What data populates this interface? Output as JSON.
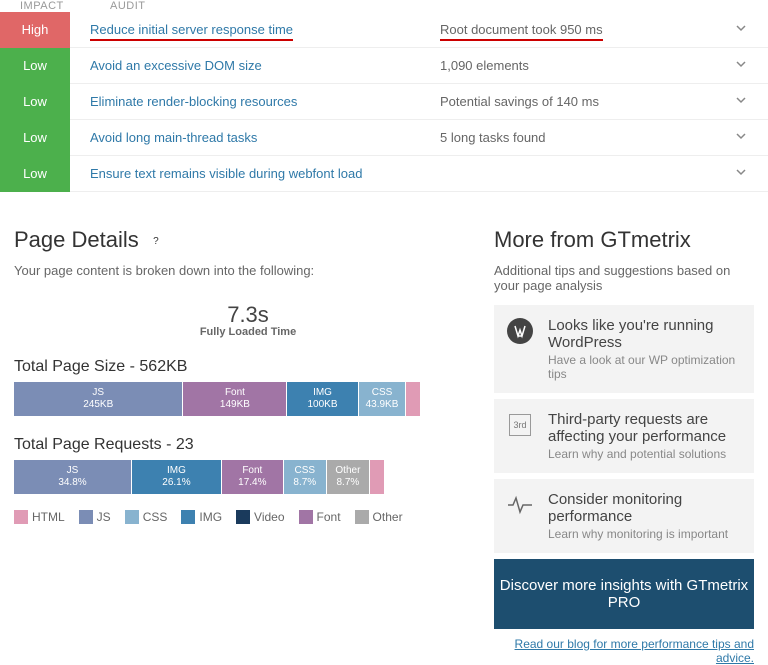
{
  "headers": {
    "impact": "IMPACT",
    "audit": "AUDIT"
  },
  "audits": [
    {
      "impact": "High",
      "name": "Reduce initial server response time",
      "detail": "Root document took 950 ms",
      "high": true
    },
    {
      "impact": "Low",
      "name": "Avoid an excessive DOM size",
      "detail": "1,090 elements"
    },
    {
      "impact": "Low",
      "name": "Eliminate render-blocking resources",
      "detail": "Potential savings of 140 ms"
    },
    {
      "impact": "Low",
      "name": "Avoid long main-thread tasks",
      "detail": "5 long tasks found"
    },
    {
      "impact": "Low",
      "name": "Ensure text remains visible during webfont load",
      "detail": ""
    }
  ],
  "page_details": {
    "title": "Page Details",
    "subtext": "Your page content is broken down into the following:",
    "flt_value": "7.3s",
    "flt_label": "Fully Loaded Time",
    "size_title": "Total Page Size - 562KB",
    "size_segs": [
      {
        "l1": "JS",
        "l2": "245KB",
        "w": 36,
        "c": "c-js"
      },
      {
        "l1": "Font",
        "l2": "149KB",
        "w": 22,
        "c": "c-font"
      },
      {
        "l1": "IMG",
        "l2": "100KB",
        "w": 15,
        "c": "c-img"
      },
      {
        "l1": "CSS",
        "l2": "43.9KB",
        "w": 10,
        "c": "c-css"
      },
      {
        "l1": "",
        "l2": "",
        "w": 3,
        "c": "c-html"
      }
    ],
    "req_title": "Total Page Requests - 23",
    "req_segs": [
      {
        "l1": "JS",
        "l2": "34.8%",
        "w": 25,
        "c": "c-js"
      },
      {
        "l1": "IMG",
        "l2": "26.1%",
        "w": 19,
        "c": "c-img"
      },
      {
        "l1": "Font",
        "l2": "17.4%",
        "w": 13,
        "c": "c-font"
      },
      {
        "l1": "CSS",
        "l2": "8.7%",
        "w": 9,
        "c": "c-css"
      },
      {
        "l1": "Other",
        "l2": "8.7%",
        "w": 9,
        "c": "c-other"
      },
      {
        "l1": "",
        "l2": "",
        "w": 3,
        "c": "c-html"
      }
    ],
    "legend": [
      "HTML",
      "JS",
      "CSS",
      "IMG",
      "Video",
      "Font",
      "Other"
    ]
  },
  "more": {
    "title": "More from GTmetrix",
    "subtext": "Additional tips and suggestions based on your page analysis",
    "tips": [
      {
        "title": "Looks like you're running WordPress",
        "sub": "Have a look at our WP optimization tips"
      },
      {
        "title": "Third-party requests are affecting your performance",
        "sub": "Learn why and potential solutions"
      },
      {
        "title": "Consider monitoring performance",
        "sub": "Learn why monitoring is important"
      }
    ],
    "promo": "Discover more insights with GTmetrix PRO",
    "blog": "Read our blog for more performance tips and advice."
  },
  "legend_colors": {
    "HTML": "c-html",
    "JS": "c-js",
    "CSS": "c-css",
    "IMG": "c-img",
    "Video": "#1a3a5c",
    "Font": "c-font",
    "Other": "c-other"
  }
}
